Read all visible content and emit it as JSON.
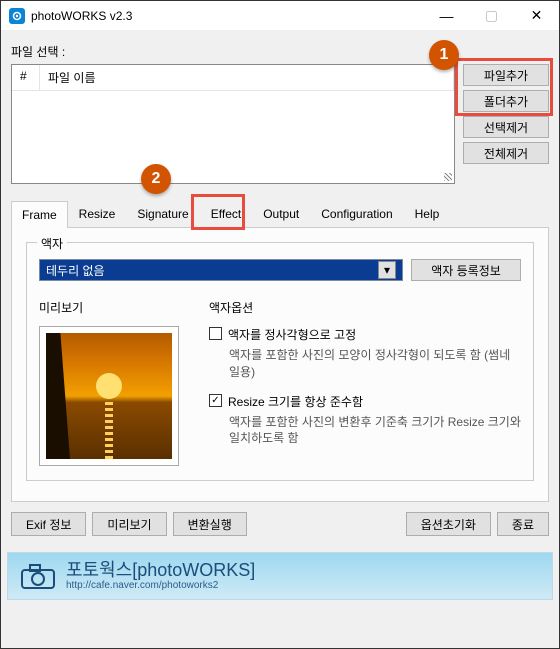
{
  "window": {
    "title": "photoWORKS v2.3"
  },
  "file_select_label": "파일 선택 :",
  "file_columns": {
    "num": "#",
    "name": "파일 이름"
  },
  "side_buttons": {
    "add_file": "파일추가",
    "add_folder": "폴더추가",
    "remove_sel": "선택제거",
    "remove_all": "전체제거"
  },
  "tabs": {
    "frame": "Frame",
    "resize": "Resize",
    "signature": "Signature",
    "effect": "Effect",
    "output": "Output",
    "config": "Configuration",
    "help": "Help"
  },
  "frame_panel": {
    "group_title": "액자",
    "combo_value": "테두리 없음",
    "reg_btn": "액자 등록정보",
    "preview_label": "미리보기",
    "opts_title": "액자옵션",
    "opt1_label": "액자를 정사각형으로 고정",
    "opt1_desc": "액자를 포함한 사진의 모양이 정사각형이 되도록 함 (썸네일용)",
    "opt2_label": "Resize 크기를 항상 준수함",
    "opt2_desc": "액자를 포함한 사진의 변환후 기준축 크기가 Resize 크기와 일치하도록 함"
  },
  "bottom": {
    "exif": "Exif 정보",
    "preview": "미리보기",
    "run": "변환실행",
    "reset": "옵션초기화",
    "close": "종료"
  },
  "footer": {
    "brand": "포토웍스[photoWORKS]",
    "url": "http://cafe.naver.com/photoworks2"
  },
  "annotations": {
    "one": "1",
    "two": "2"
  }
}
